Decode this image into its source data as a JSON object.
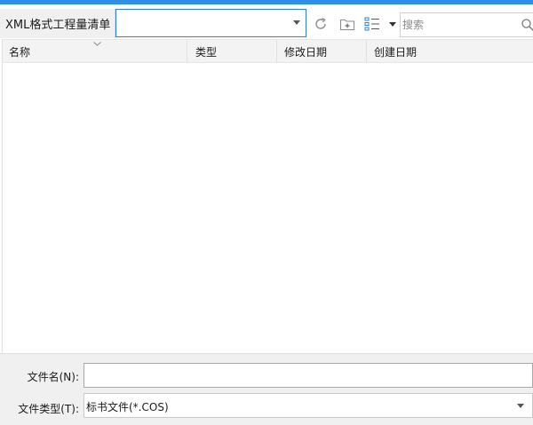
{
  "location": {
    "label": "XML格式工程量清单",
    "path_value": ""
  },
  "toolbar": {
    "refresh_icon": "refresh-icon",
    "new_folder_icon": "new-folder-icon",
    "view_icon": "view-list-icon",
    "search_placeholder": "搜索"
  },
  "list": {
    "columns": [
      "名称",
      "类型",
      "修改日期",
      "创建日期"
    ],
    "rows": []
  },
  "bottom": {
    "filename_label": "文件名(N):",
    "filename_value": "",
    "filetype_label": "文件类型(T):",
    "filetype_value": "标书文件(*.COS)"
  },
  "colors": {
    "accent": "#2f8ee8",
    "header_bg": "#f3f3f3",
    "panel_bg": "#f0f0f0"
  }
}
